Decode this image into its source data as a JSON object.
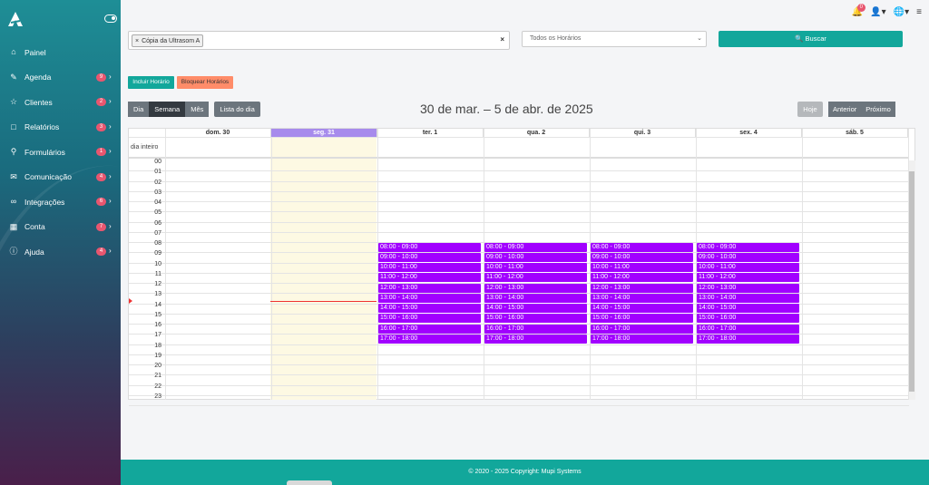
{
  "sidebar": {
    "items": [
      {
        "label": "Painel",
        "icon": "home-icon",
        "badge": ""
      },
      {
        "label": "Agenda",
        "icon": "calendar-edit-icon",
        "badge": "9"
      },
      {
        "label": "Clientes",
        "icon": "star-icon",
        "badge": "2"
      },
      {
        "label": "Relatórios",
        "icon": "book-icon",
        "badge": "3"
      },
      {
        "label": "Formulários",
        "icon": "search-icon",
        "badge": "1"
      },
      {
        "label": "Comunicação",
        "icon": "envelope-icon",
        "badge": "4"
      },
      {
        "label": "Integrações",
        "icon": "link-icon",
        "badge": "6"
      },
      {
        "label": "Conta",
        "icon": "building-icon",
        "badge": "7"
      },
      {
        "label": "Ajuda",
        "icon": "question-icon",
        "badge": "4"
      }
    ]
  },
  "topbar": {
    "notifications": "0"
  },
  "filter": {
    "chip": "Cópia da Ultrasom A",
    "clear": "×",
    "chip_x": "×"
  },
  "select": {
    "value": "Todos os Horários"
  },
  "buscar": {
    "label": "Buscar"
  },
  "actions": {
    "incluir": "Incluir Horário",
    "bloquear": "Bloquear Horários"
  },
  "views": {
    "dia": "Dia",
    "semana": "Semana",
    "mes": "Mês",
    "lista": "Lista do dia"
  },
  "title": "30 de mar. – 5 de abr. de 2025",
  "nav": {
    "hoje": "Hoje",
    "anterior": "Anterior",
    "proximo": "Próximo"
  },
  "allday": "dia inteiro",
  "days": [
    "dom. 30",
    "seg. 31",
    "ter. 1",
    "qua. 2",
    "qui. 3",
    "sex. 4",
    "sáb. 5"
  ],
  "hours": [
    "00",
    "01",
    "02",
    "03",
    "04",
    "05",
    "06",
    "07",
    "08",
    "09",
    "10",
    "11",
    "12",
    "13",
    "14",
    "15",
    "16",
    "17",
    "18",
    "19",
    "20",
    "21",
    "22",
    "23"
  ],
  "event_slots": [
    "08:00 - 09:00",
    "09:00 - 10:00",
    "10:00 - 11:00",
    "11:00 - 12:00",
    "12:00 - 13:00",
    "13:00 - 14:00",
    "14:00 - 15:00",
    "15:00 - 16:00",
    "16:00 - 17:00",
    "17:00 - 18:00"
  ],
  "event_days": [
    2,
    3,
    4,
    5
  ],
  "footer": "© 2020 - 2025 Copyright: Mupi Systems",
  "colors": {
    "accent": "#12a79b",
    "event": "#a100ff",
    "today_header": "#a78bec",
    "today_bg": "#fdf9e3",
    "badge": "#e8566f",
    "bloquear": "#ff8c69"
  }
}
